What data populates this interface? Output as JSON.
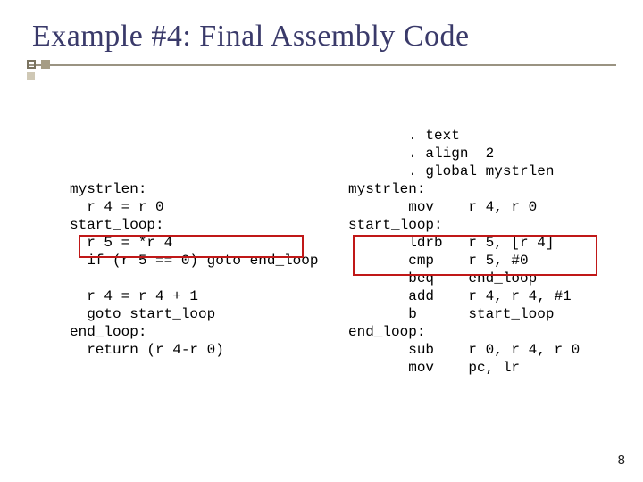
{
  "title": "Example #4: Final Assembly Code",
  "left_code": "mystrlen:\n  r 4 = r 0\nstart_loop:\n  r 5 = *r 4\n  if (r 5 == 0) goto end_loop\n\n  r 4 = r 4 + 1\n  goto start_loop\nend_loop:\n  return (r 4-r 0)",
  "right_code": "       . text\n       . align  2\n       . global mystrlen\nmystrlen:\n       mov    r 4, r 0\nstart_loop:\n       ldrb   r 5, [r 4]\n       cmp    r 5, #0\n       beq    end_loop\n       add    r 4, r 4, #1\n       b      start_loop\nend_loop:\n       sub    r 0, r 4, r 0\n       mov    pc, lr",
  "page_number": "8"
}
